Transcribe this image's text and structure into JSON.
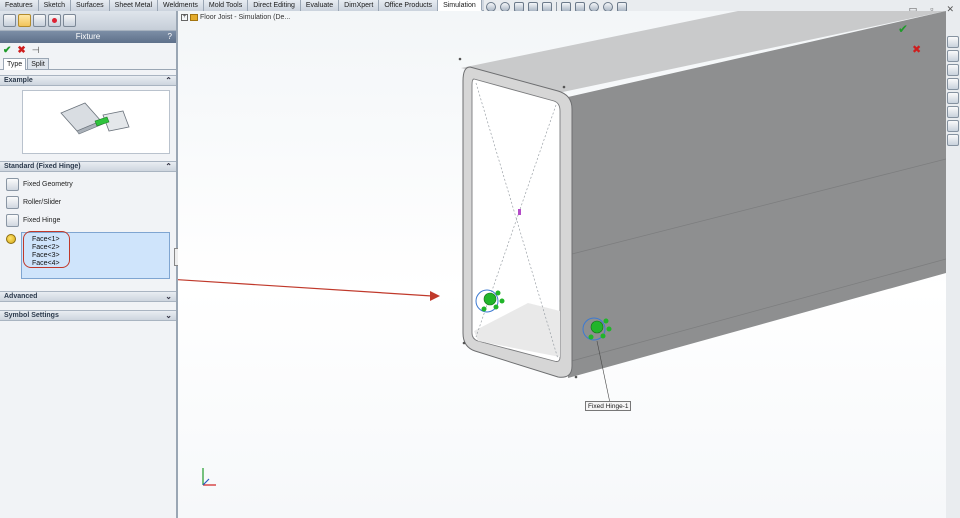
{
  "command_tabs": [
    {
      "label": "Features"
    },
    {
      "label": "Sketch"
    },
    {
      "label": "Surfaces"
    },
    {
      "label": "Sheet Metal"
    },
    {
      "label": "Weldments"
    },
    {
      "label": "Mold Tools"
    },
    {
      "label": "Direct Editing"
    },
    {
      "label": "Evaluate"
    },
    {
      "label": "DimXpert"
    },
    {
      "label": "Office Products"
    },
    {
      "label": "Simulation",
      "active": true
    }
  ],
  "view_toolbar_icons": [
    "zoom-fit-icon",
    "zoom-area-icon",
    "previous-view-icon",
    "section-view-icon",
    "view-orientation-icon",
    "display-style-icon",
    "hide-show-icon",
    "edit-appearance-icon",
    "apply-scene-icon",
    "view-settings-icon"
  ],
  "window_controls": {
    "minimize": "▭",
    "restore": "▫",
    "close": "✕"
  },
  "property_manager": {
    "title": "Fixture",
    "help": "?",
    "actions": {
      "ok": "✔",
      "cancel": "✖",
      "pin": "⊣"
    },
    "tabs": [
      {
        "label": "Type",
        "active": true
      },
      {
        "label": "Split"
      }
    ],
    "groups": {
      "example": {
        "title": "Example",
        "chevron": "⌃"
      },
      "standard": {
        "title": "Standard (Fixed Hinge)",
        "chevron": "⌃",
        "options": [
          {
            "label": "Fixed Geometry",
            "icon": "fixed-geometry-icon"
          },
          {
            "label": "Roller/Slider",
            "icon": "roller-slider-icon"
          },
          {
            "label": "Fixed Hinge",
            "icon": "fixed-hinge-icon"
          }
        ],
        "selected_faces": [
          "Face<1>",
          "Face<2>",
          "Face<3>",
          "Face<4>"
        ]
      },
      "advanced": {
        "title": "Advanced",
        "chevron": "⌄"
      },
      "symbol_settings": {
        "title": "Symbol Settings",
        "chevron": "⌄"
      }
    }
  },
  "graphics": {
    "tree_label": "Floor Joist - Simulation (De...",
    "callout_label": "Fixed Hinge-1"
  },
  "colors": {
    "accent_red": "#c0392b",
    "selection_blue": "#cfe4fb",
    "fixture_green": "#21b52a",
    "model_gray": "#8e8f90"
  }
}
